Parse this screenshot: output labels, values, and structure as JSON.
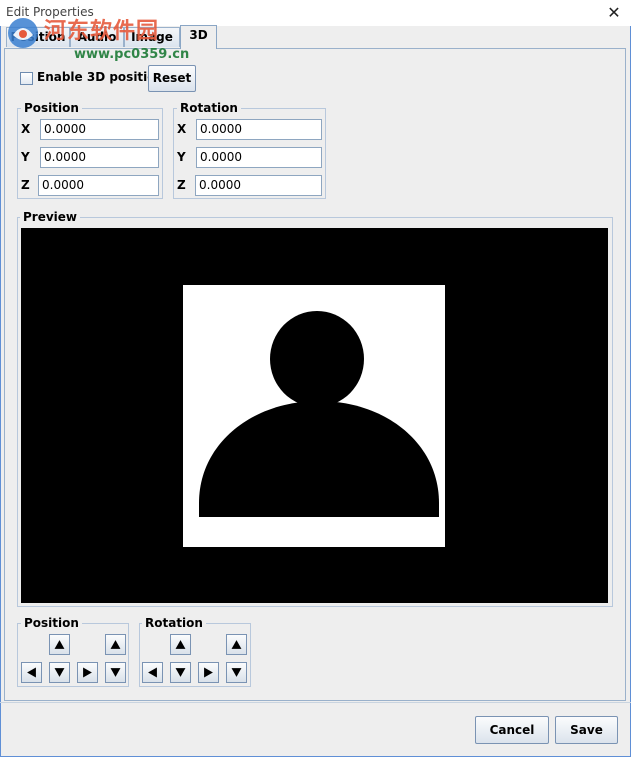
{
  "window": {
    "title": "Edit Properties",
    "close_glyph": "✕"
  },
  "watermark": {
    "text": "河东软件园",
    "url": "www.pc0359.cn",
    "logo_icon": "watermark-logo-icon"
  },
  "tabs": [
    {
      "label": "Position",
      "active": false
    },
    {
      "label": "Audio",
      "active": false
    },
    {
      "label": "Image",
      "active": false
    },
    {
      "label": "3D",
      "active": true
    }
  ],
  "enable3d": {
    "label": "Enable 3D position",
    "checked": false
  },
  "reset_label": "Reset",
  "position_group": {
    "title": "Position",
    "fields": [
      {
        "axis": "X",
        "value": "0.0000"
      },
      {
        "axis": "Y",
        "value": "0.0000"
      },
      {
        "axis": "Z",
        "value": "0.0000"
      }
    ]
  },
  "rotation_group": {
    "title": "Rotation",
    "fields": [
      {
        "axis": "X",
        "value": "0.0000"
      },
      {
        "axis": "Y",
        "value": "0.0000"
      },
      {
        "axis": "Z",
        "value": "0.0000"
      }
    ]
  },
  "preview": {
    "title": "Preview",
    "image_icon": "person-silhouette-icon"
  },
  "position_arrows": {
    "title": "Position"
  },
  "rotation_arrows": {
    "title": "Rotation"
  },
  "buttons": {
    "cancel": "Cancel",
    "save": "Save"
  },
  "colors": {
    "accent_border": "#5f8fd6",
    "panel_bg": "#eeeeee",
    "preview_bg": "#000000"
  }
}
